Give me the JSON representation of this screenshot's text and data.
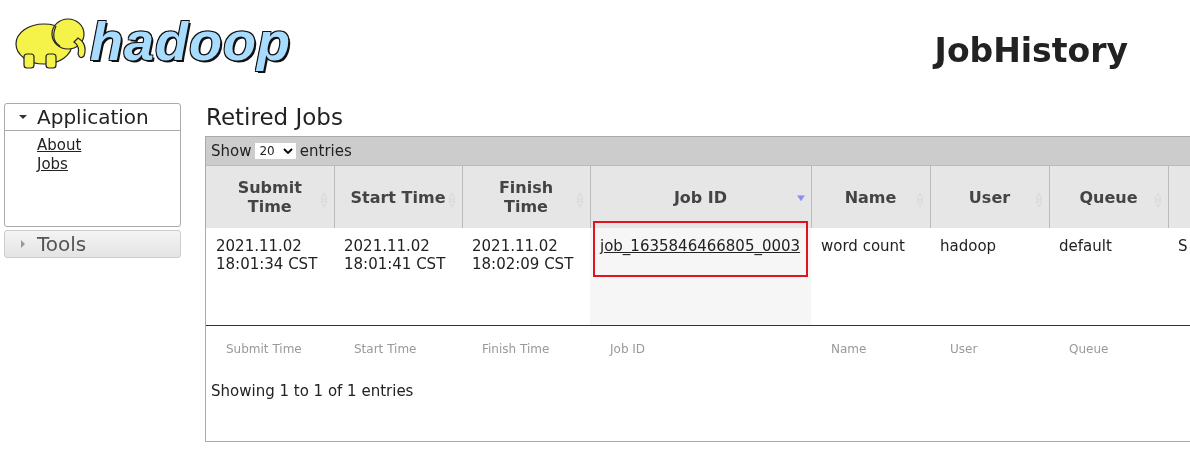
{
  "header": {
    "logo_text": "hadoop",
    "title": "JobHistory"
  },
  "sidebar": [
    {
      "label": "Application",
      "expanded": true,
      "links": [
        "About",
        "Jobs"
      ]
    },
    {
      "label": "Tools",
      "expanded": false
    }
  ],
  "main": {
    "title": "Retired Jobs",
    "toolbar": {
      "show_label": "Show",
      "page_size": "20",
      "entries_label": "entries"
    },
    "table": {
      "columns": [
        {
          "label": "Submit Time",
          "sorted": false
        },
        {
          "label": "Start Time",
          "sorted": false
        },
        {
          "label": "Finish Time",
          "sorted": false
        },
        {
          "label": "Job ID",
          "sorted": true
        },
        {
          "label": "Name",
          "sorted": false
        },
        {
          "label": "User",
          "sorted": false
        },
        {
          "label": "Queue",
          "sorted": false
        }
      ],
      "rows": [
        {
          "cells": [
            {
              "kind": "text",
              "text": "2021.11.02\n18:01:34 CST"
            },
            {
              "kind": "text",
              "text": "2021.11.02\n18:01:41 CST"
            },
            {
              "kind": "text",
              "text": "2021.11.02\n18:02:09 CST"
            },
            {
              "kind": "link",
              "text": "job_1635846466805_0003"
            },
            {
              "kind": "text",
              "text": "word count"
            },
            {
              "kind": "text",
              "text": "hadoop"
            },
            {
              "kind": "text",
              "text": "default"
            },
            {
              "kind": "text",
              "text": "S"
            }
          ]
        }
      ],
      "footer_columns": [
        "Submit Time",
        "Start Time",
        "Finish Time",
        "Job ID",
        "Name",
        "User",
        "Queue"
      ],
      "info": "Showing 1 to 1 of 1 entries"
    }
  }
}
